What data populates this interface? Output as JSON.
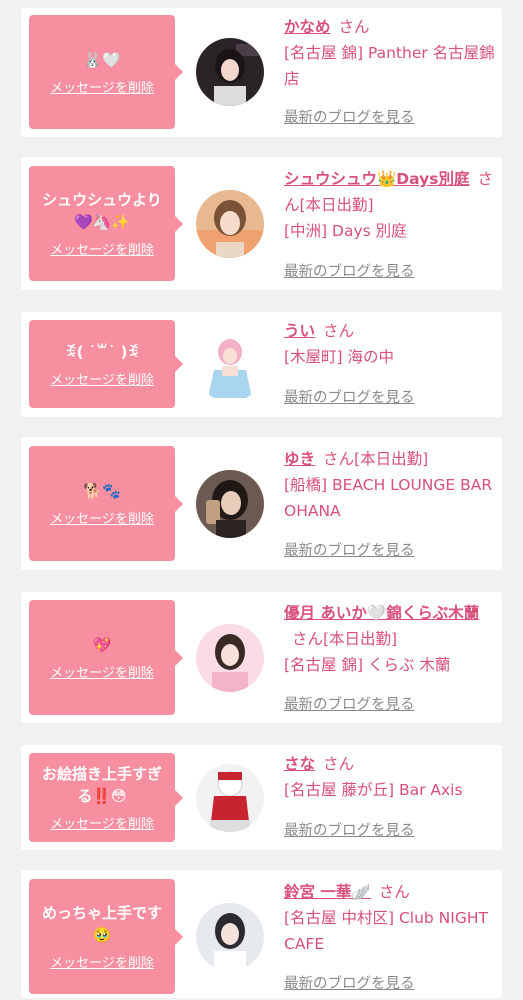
{
  "colors": {
    "bubble": "#f78fa0",
    "accent": "#d9507a",
    "muted": "#8a8a8a",
    "background": "#f1f1f1",
    "card": "#ffffff"
  },
  "delete_label": "メッセージを削除",
  "blog_label": "最新のブログを見る",
  "messages": [
    {
      "message": "🐰🤍",
      "name": "かなめ",
      "suffix": "さん",
      "location": "[名古屋 錦] Panther 名古屋錦店",
      "avatar": "avatar-photo"
    },
    {
      "message": "シュウシュウより\n💜🦄✨",
      "name": "シュウシュウ👑Days別庭",
      "suffix": "さん[本日出勤]",
      "location": "[中洲] Days 別庭",
      "avatar": "avatar-photo"
    },
    {
      "message": "ꉂ( ˙꒳​˙ )ꉂ",
      "name": "うい",
      "suffix": "さん",
      "location": "[木屋町] 海の中",
      "avatar": "avatar-photo"
    },
    {
      "message": "🐕🐾",
      "name": "ゆき",
      "suffix": "さん[本日出勤]",
      "location": "[船橋] BEACH LOUNGE BAR OHANA",
      "avatar": "avatar-photo"
    },
    {
      "message": "💖",
      "name": "優月 あいか🤍錦くらぶ木蘭",
      "suffix": "さん[本日出勤]",
      "location": "[名古屋 錦] くらぶ 木蘭",
      "avatar": "avatar-photo"
    },
    {
      "message": "お絵描き上手すぎる‼️😳",
      "name": "さな",
      "suffix": "さん",
      "location": "[名古屋 藤が丘] Bar Axis",
      "avatar": "avatar-photo"
    },
    {
      "message": "めっちゃ上手です🥹",
      "name": "鈴宮 一華🪽",
      "suffix": "さん",
      "location": "[名古屋 中村区] Club NIGHT CAFE",
      "avatar": "avatar-photo"
    }
  ]
}
